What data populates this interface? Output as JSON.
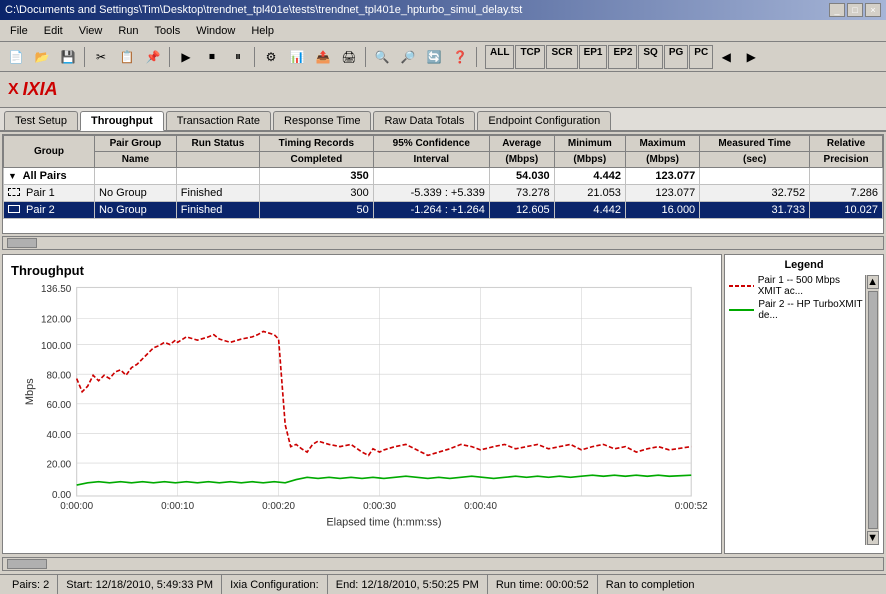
{
  "window": {
    "title": "C:\\Documents and Settings\\Tim\\Desktop\\trendnet_tpl401e\\tests\\trendnet_tpl401e_hpturbo_simul_delay.tst"
  },
  "menu": {
    "items": [
      "File",
      "Edit",
      "View",
      "Run",
      "Tools",
      "Window",
      "Help"
    ]
  },
  "toolbar": {
    "protocols": [
      "ALL",
      "TCP",
      "SCR",
      "EP1",
      "EP2",
      "SQ",
      "PG",
      "PC"
    ]
  },
  "tabs": {
    "main_tabs": [
      "Test Setup",
      "Throughput",
      "Transaction Rate",
      "Response Time",
      "Raw Data Totals",
      "Endpoint Configuration"
    ]
  },
  "table": {
    "headers": {
      "group": "Group",
      "pair_group_name": "Pair Group Name",
      "run_status": "Run Status",
      "timing_records": "Timing Records Completed",
      "confidence_interval": "95% Confidence Interval",
      "average": "Average (Mbps)",
      "minimum": "Minimum (Mbps)",
      "maximum": "Maximum (Mbps)",
      "measured_time": "Measured Time (sec)",
      "relative_precision": "Relative Precision"
    },
    "rows": [
      {
        "type": "all_pairs",
        "group": "All Pairs",
        "pair_name": "",
        "group_name": "",
        "run_status": "",
        "timing_records": "350",
        "confidence_interval": "",
        "average": "54.030",
        "minimum": "4.442",
        "maximum": "123.077",
        "measured_time": "",
        "relative_precision": ""
      },
      {
        "type": "pair",
        "pair_num": "Pair 1",
        "group_name": "No Group",
        "run_status": "Finished",
        "timing_records": "300",
        "confidence_interval": "-5.339 : +5.339",
        "average": "73.278",
        "minimum": "21.053",
        "maximum": "123.077",
        "measured_time": "32.752",
        "relative_precision": "7.286"
      },
      {
        "type": "pair",
        "pair_num": "Pair 2",
        "group_name": "No Group",
        "run_status": "Finished",
        "timing_records": "50",
        "confidence_interval": "-1.264 : +1.264",
        "average": "12.605",
        "minimum": "4.442",
        "maximum": "16.000",
        "measured_time": "31.733",
        "relative_precision": "10.027"
      }
    ]
  },
  "chart": {
    "title": "Throughput",
    "y_label": "Mbps",
    "x_label": "Elapsed time (h:mm:ss)",
    "y_max": "136.50",
    "y_ticks": [
      "136.50",
      "120.00",
      "100.00",
      "80.00",
      "60.00",
      "40.00",
      "20.00",
      "0.00"
    ],
    "x_ticks": [
      "0:00:00",
      "0:00:10",
      "0:00:20",
      "0:00:30",
      "0:00:40",
      "0:00:52"
    ]
  },
  "legend": {
    "title": "Legend",
    "items": [
      {
        "label": "Pair 1 -- 500 Mbps XMIT ac...",
        "color": "#cc0000",
        "style": "dashed"
      },
      {
        "label": "Pair 2 -- HP TurboXMIT de...",
        "color": "#00aa00",
        "style": "solid"
      }
    ]
  },
  "status_bar": {
    "pairs": "Pairs: 2",
    "start": "Start: 12/18/2010, 5:49:33 PM",
    "ixia_config": "Ixia Configuration:",
    "end": "End: 12/18/2010, 5:50:25 PM",
    "run_time": "Run time: 00:00:52",
    "status": "Ran to completion"
  }
}
